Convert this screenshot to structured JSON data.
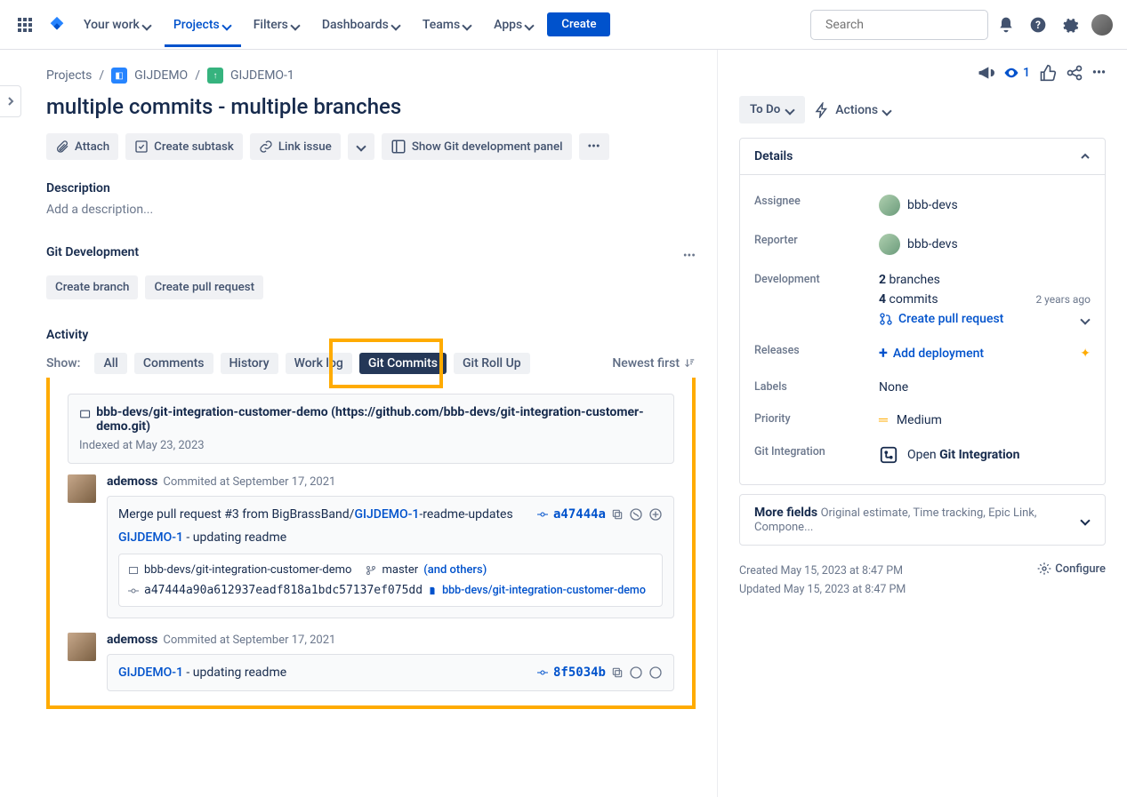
{
  "nav": {
    "your_work": "Your work",
    "projects": "Projects",
    "filters": "Filters",
    "dashboards": "Dashboards",
    "teams": "Teams",
    "apps": "Apps",
    "create": "Create",
    "search_placeholder": "Search"
  },
  "breadcrumb": {
    "root": "Projects",
    "project": "GIJDEMO",
    "issue": "GIJDEMO-1"
  },
  "issue": {
    "title": "multiple commits - multiple branches",
    "attach": "Attach",
    "create_subtask": "Create subtask",
    "link_issue": "Link issue",
    "show_git_panel": "Show Git development panel",
    "description_label": "Description",
    "description_placeholder": "Add a description...",
    "git_dev_label": "Git Development",
    "create_branch": "Create branch",
    "create_pr": "Create pull request"
  },
  "activity": {
    "label": "Activity",
    "show": "Show:",
    "tabs": {
      "all": "All",
      "comments": "Comments",
      "history": "History",
      "worklog": "Work log",
      "git_commits": "Git Commits",
      "git_rollup": "Git Roll Up"
    },
    "sort": "Newest first"
  },
  "repo": {
    "name": "bbb-devs/git-integration-customer-demo (https://github.com/bbb-devs/git-integration-customer-demo.git)",
    "indexed": "Indexed at May 23, 2023"
  },
  "commits": [
    {
      "author": "ademoss",
      "date": "Commited at September 17, 2021",
      "msg_prefix": "Merge pull request #3 from BigBrassBand/",
      "msg_link": "GIJDEMO-1",
      "msg_suffix": "-readme-updates",
      "hash_short": "a47444a",
      "ref_link": "GIJDEMO-1",
      "ref_text": " - updating readme",
      "sub_repo": "bbb-devs/git-integration-customer-demo",
      "sub_branch": "master",
      "sub_branch_others": "(and others)",
      "sub_hash": "a47444a90a612937eadf818a1bdc57137ef075dd",
      "sub_repo_link": "bbb-devs/git-integration-customer-demo"
    },
    {
      "author": "ademoss",
      "date": "Commited at September 17, 2021",
      "ref_link": "GIJDEMO-1",
      "ref_text": " - updating readme",
      "hash_short": "8f5034b"
    }
  ],
  "side": {
    "watchers": "1",
    "status": "To Do",
    "actions": "Actions",
    "details": "Details",
    "assignee_label": "Assignee",
    "assignee": "bbb-devs",
    "reporter_label": "Reporter",
    "reporter": "bbb-devs",
    "development_label": "Development",
    "branches_count": "2",
    "branches_text": " branches",
    "commits_count": "4",
    "commits_text": " commits",
    "commits_age": "2 years ago",
    "create_pr": "Create pull request",
    "releases_label": "Releases",
    "add_deployment": "Add deployment",
    "labels_label": "Labels",
    "labels_value": "None",
    "priority_label": "Priority",
    "priority_value": "Medium",
    "git_integration_label": "Git Integration",
    "git_integration_open": "Open ",
    "git_integration_name": "Git Integration",
    "more_fields": "More fields",
    "more_fields_list": "Original estimate, Time tracking, Epic Link, Compone...",
    "created": "Created May 15, 2023 at 8:47 PM",
    "updated": "Updated May 15, 2023 at 8:47 PM",
    "configure": "Configure"
  }
}
